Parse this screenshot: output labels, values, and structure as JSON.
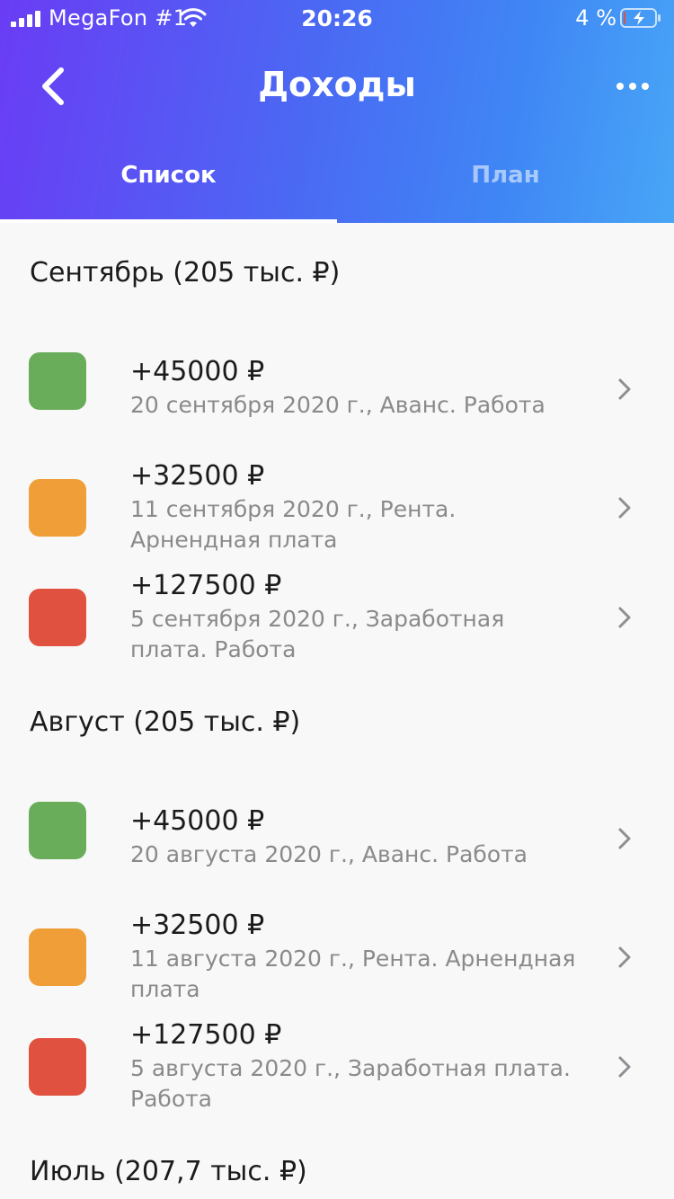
{
  "status_bar": {
    "carrier": "MegaFon #1",
    "time": "20:26",
    "battery": "4 %"
  },
  "nav": {
    "title": "Доходы",
    "back_icon": "chevron-left-icon",
    "more_icon": "more-horizontal-icon"
  },
  "tabs": [
    {
      "label": "Список",
      "active": true
    },
    {
      "label": "План",
      "active": false
    }
  ],
  "colors": {
    "green": "#69ad5a",
    "orange": "#f09f38",
    "red": "#e0513f"
  },
  "sections": [
    {
      "title": "Сентябрь (205 тыс. ₽)",
      "items": [
        {
          "amount": "+45000 ₽",
          "desc": "20 сентября 2020 г., Аванс. Работа",
          "color": "green"
        },
        {
          "amount": "+32500 ₽",
          "desc": "11 сентября 2020 г., Рента. Арнендная плата",
          "color": "orange"
        },
        {
          "amount": "+127500 ₽",
          "desc": "5 сентября 2020 г., Заработная плата. Работа",
          "color": "red"
        }
      ]
    },
    {
      "title": "Август (205 тыс. ₽)",
      "items": [
        {
          "amount": "+45000 ₽",
          "desc": "20 августа 2020 г., Аванс. Работа",
          "color": "green"
        },
        {
          "amount": "+32500 ₽",
          "desc": "11 августа 2020 г., Рента. Арнендная плата",
          "color": "orange"
        },
        {
          "amount": "+127500 ₽",
          "desc": "5 августа 2020 г., Заработная плата. Работа",
          "color": "red"
        }
      ]
    },
    {
      "title": "Июль (207,7 тыс. ₽)",
      "items": []
    }
  ]
}
